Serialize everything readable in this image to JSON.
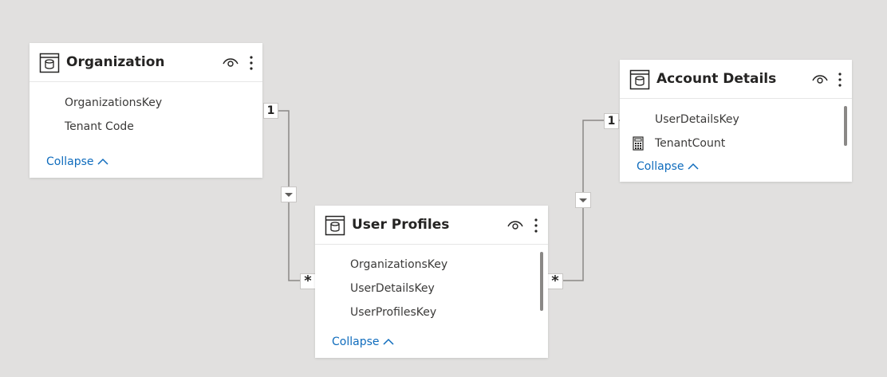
{
  "tables": {
    "organization": {
      "title": "Organization",
      "fields": [
        "OrganizationsKey",
        "Tenant Code"
      ],
      "collapse_label": "Collapse"
    },
    "account_details": {
      "title": "Account Details",
      "fields": [
        "UserDetailsKey",
        "TenantCount"
      ],
      "collapse_label": "Collapse"
    },
    "user_profiles": {
      "title": "User Profiles",
      "fields": [
        "OrganizationsKey",
        "UserDetailsKey",
        "UserProfilesKey"
      ],
      "collapse_label": "Collapse"
    }
  },
  "relationships": {
    "org_to_profiles": {
      "from_cardinality": "1",
      "to_cardinality": "*",
      "direction": "single"
    },
    "account_to_profiles": {
      "from_cardinality": "1",
      "to_cardinality": "*",
      "direction": "single"
    }
  },
  "colors": {
    "canvas": "#e1e0df",
    "link": "#0f6cbd",
    "line": "#8a8886"
  }
}
